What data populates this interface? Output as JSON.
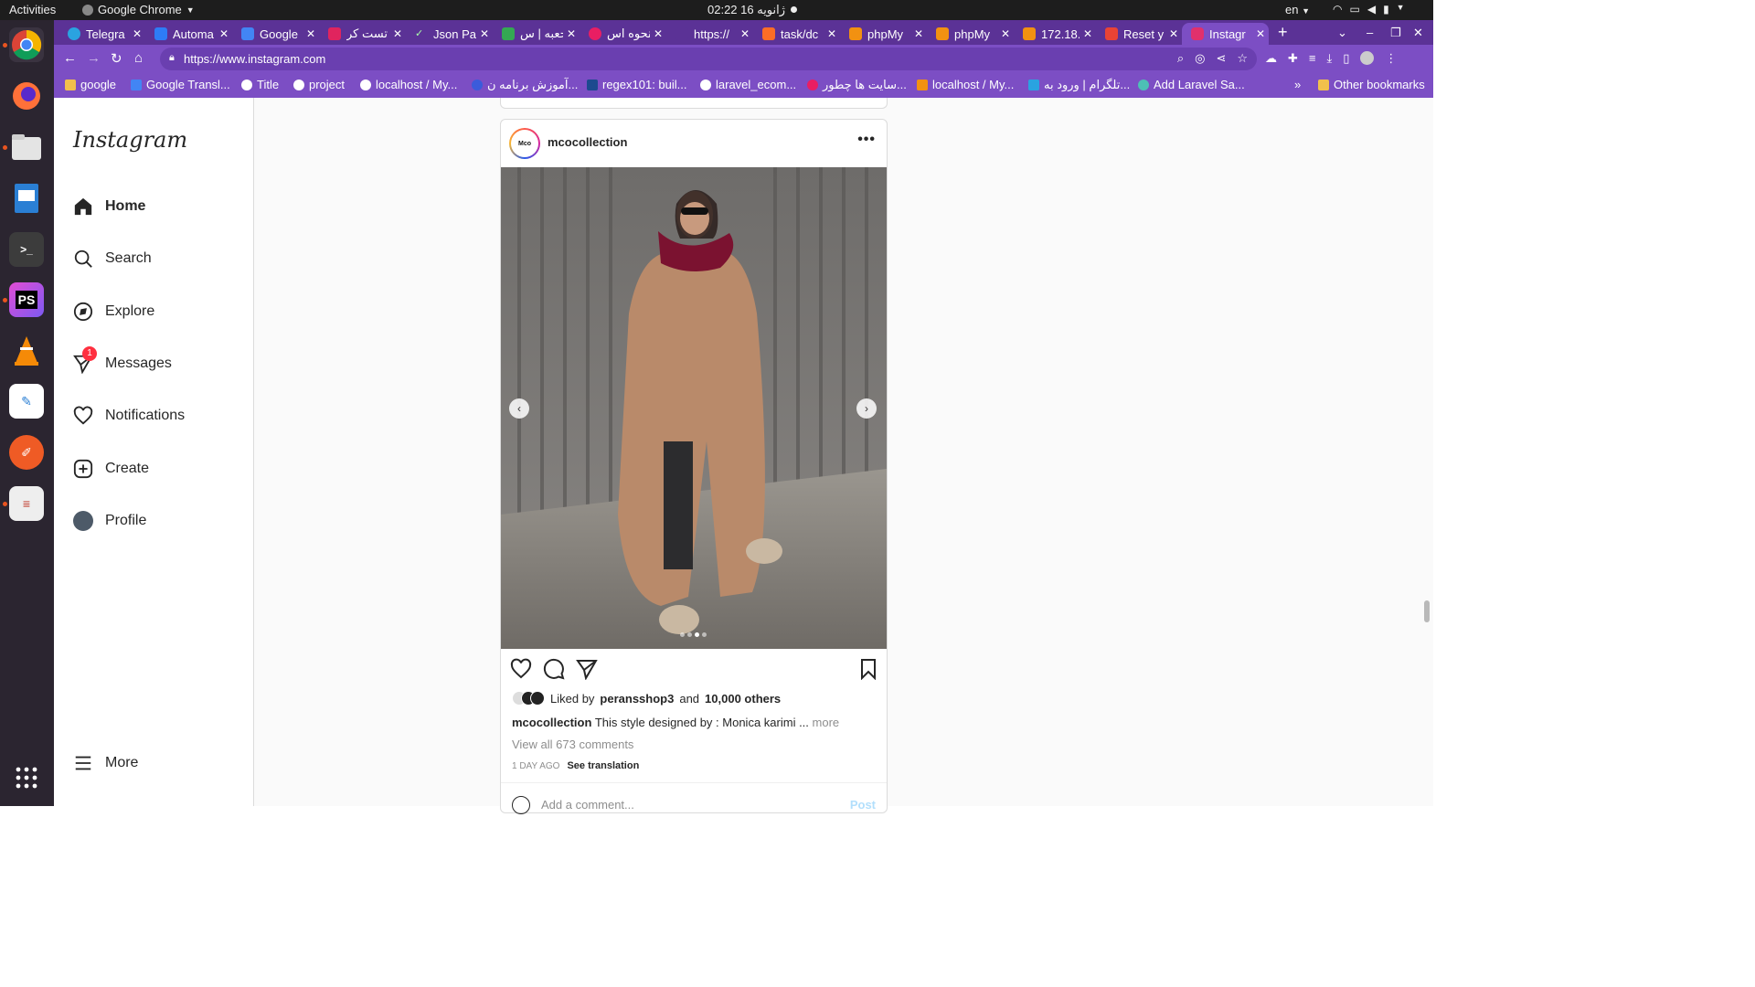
{
  "system": {
    "activities": "Activities",
    "app_name": "Google Chrome",
    "clock": "02:22  16 ژانویه",
    "language": "en"
  },
  "tabs": [
    {
      "label": "Telegra",
      "favicon_color": "#2aa3e0"
    },
    {
      "label": "Automa",
      "favicon_color": "#2e7cf6"
    },
    {
      "label": "Google",
      "favicon_color": "#4285f4"
    },
    {
      "label": "تست کر",
      "favicon_color": "#e0245e"
    },
    {
      "label": "Json Pa",
      "favicon_color": "#1f1f1f"
    },
    {
      "label": "جعبه | س",
      "favicon_color": "#34a853"
    },
    {
      "label": "نحوه اس",
      "favicon_color": "#e91e63"
    },
    {
      "label": "https://",
      "favicon_color": "#5b3296"
    },
    {
      "label": "task/dc",
      "favicon_color": "#fc6d26"
    },
    {
      "label": "phpMy",
      "favicon_color": "#f29111"
    },
    {
      "label": "phpMy",
      "favicon_color": "#f29111"
    },
    {
      "label": "172.18.",
      "favicon_color": "#f29111"
    },
    {
      "label": "Reset y",
      "favicon_color": "#ea4335"
    },
    {
      "label": "Instagr",
      "favicon_color": "#e1306c"
    }
  ],
  "address_bar": {
    "url": "https://www.instagram.com"
  },
  "bookmarks": [
    {
      "label": "google"
    },
    {
      "label": "Google Transl..."
    },
    {
      "label": "Title"
    },
    {
      "label": "project"
    },
    {
      "label": "localhost / My..."
    },
    {
      "label": "آموزش برنامه ن..."
    },
    {
      "label": "regex101: buil..."
    },
    {
      "label": "laravel_ecom..."
    },
    {
      "label": "سایت ها چطور..."
    },
    {
      "label": "localhost / My..."
    },
    {
      "label": "تلگرام | ورود به..."
    },
    {
      "label": "Add Laravel Sa..."
    }
  ],
  "bookmarks_overflow": "»",
  "other_bookmarks": "Other bookmarks",
  "instagram": {
    "logo": "Instagram",
    "nav": [
      {
        "label": "Home",
        "icon": "home-icon"
      },
      {
        "label": "Search",
        "icon": "search-icon"
      },
      {
        "label": "Explore",
        "icon": "compass-icon"
      },
      {
        "label": "Messages",
        "icon": "messenger-icon",
        "badge": "1"
      },
      {
        "label": "Notifications",
        "icon": "heart-icon"
      },
      {
        "label": "Create",
        "icon": "plus-square-icon"
      },
      {
        "label": "Profile",
        "icon": "avatar"
      }
    ],
    "more": "More",
    "post": {
      "username": "mcocollection",
      "avatar_text": "Mco",
      "carousel_dots": 4,
      "carousel_active": 3,
      "liked_by_prefix": "Liked by",
      "liked_by_user": "peransshop3",
      "liked_and": "and",
      "liked_others": "10,000 others",
      "caption_user": "mcocollection",
      "caption_text": "This style designed by : Monica karimi ...",
      "caption_more": "more",
      "view_comments": "View all 673 comments",
      "time_ago": "1 DAY AGO",
      "see_translation": "See translation",
      "comment_placeholder": "Add a comment...",
      "post_button": "Post"
    }
  },
  "colors": {
    "chrome_theme": "#7c4ec4",
    "tabstrip": "#5b3296",
    "notification_badge": "#ff3040",
    "post_button": "#b2dffc"
  }
}
